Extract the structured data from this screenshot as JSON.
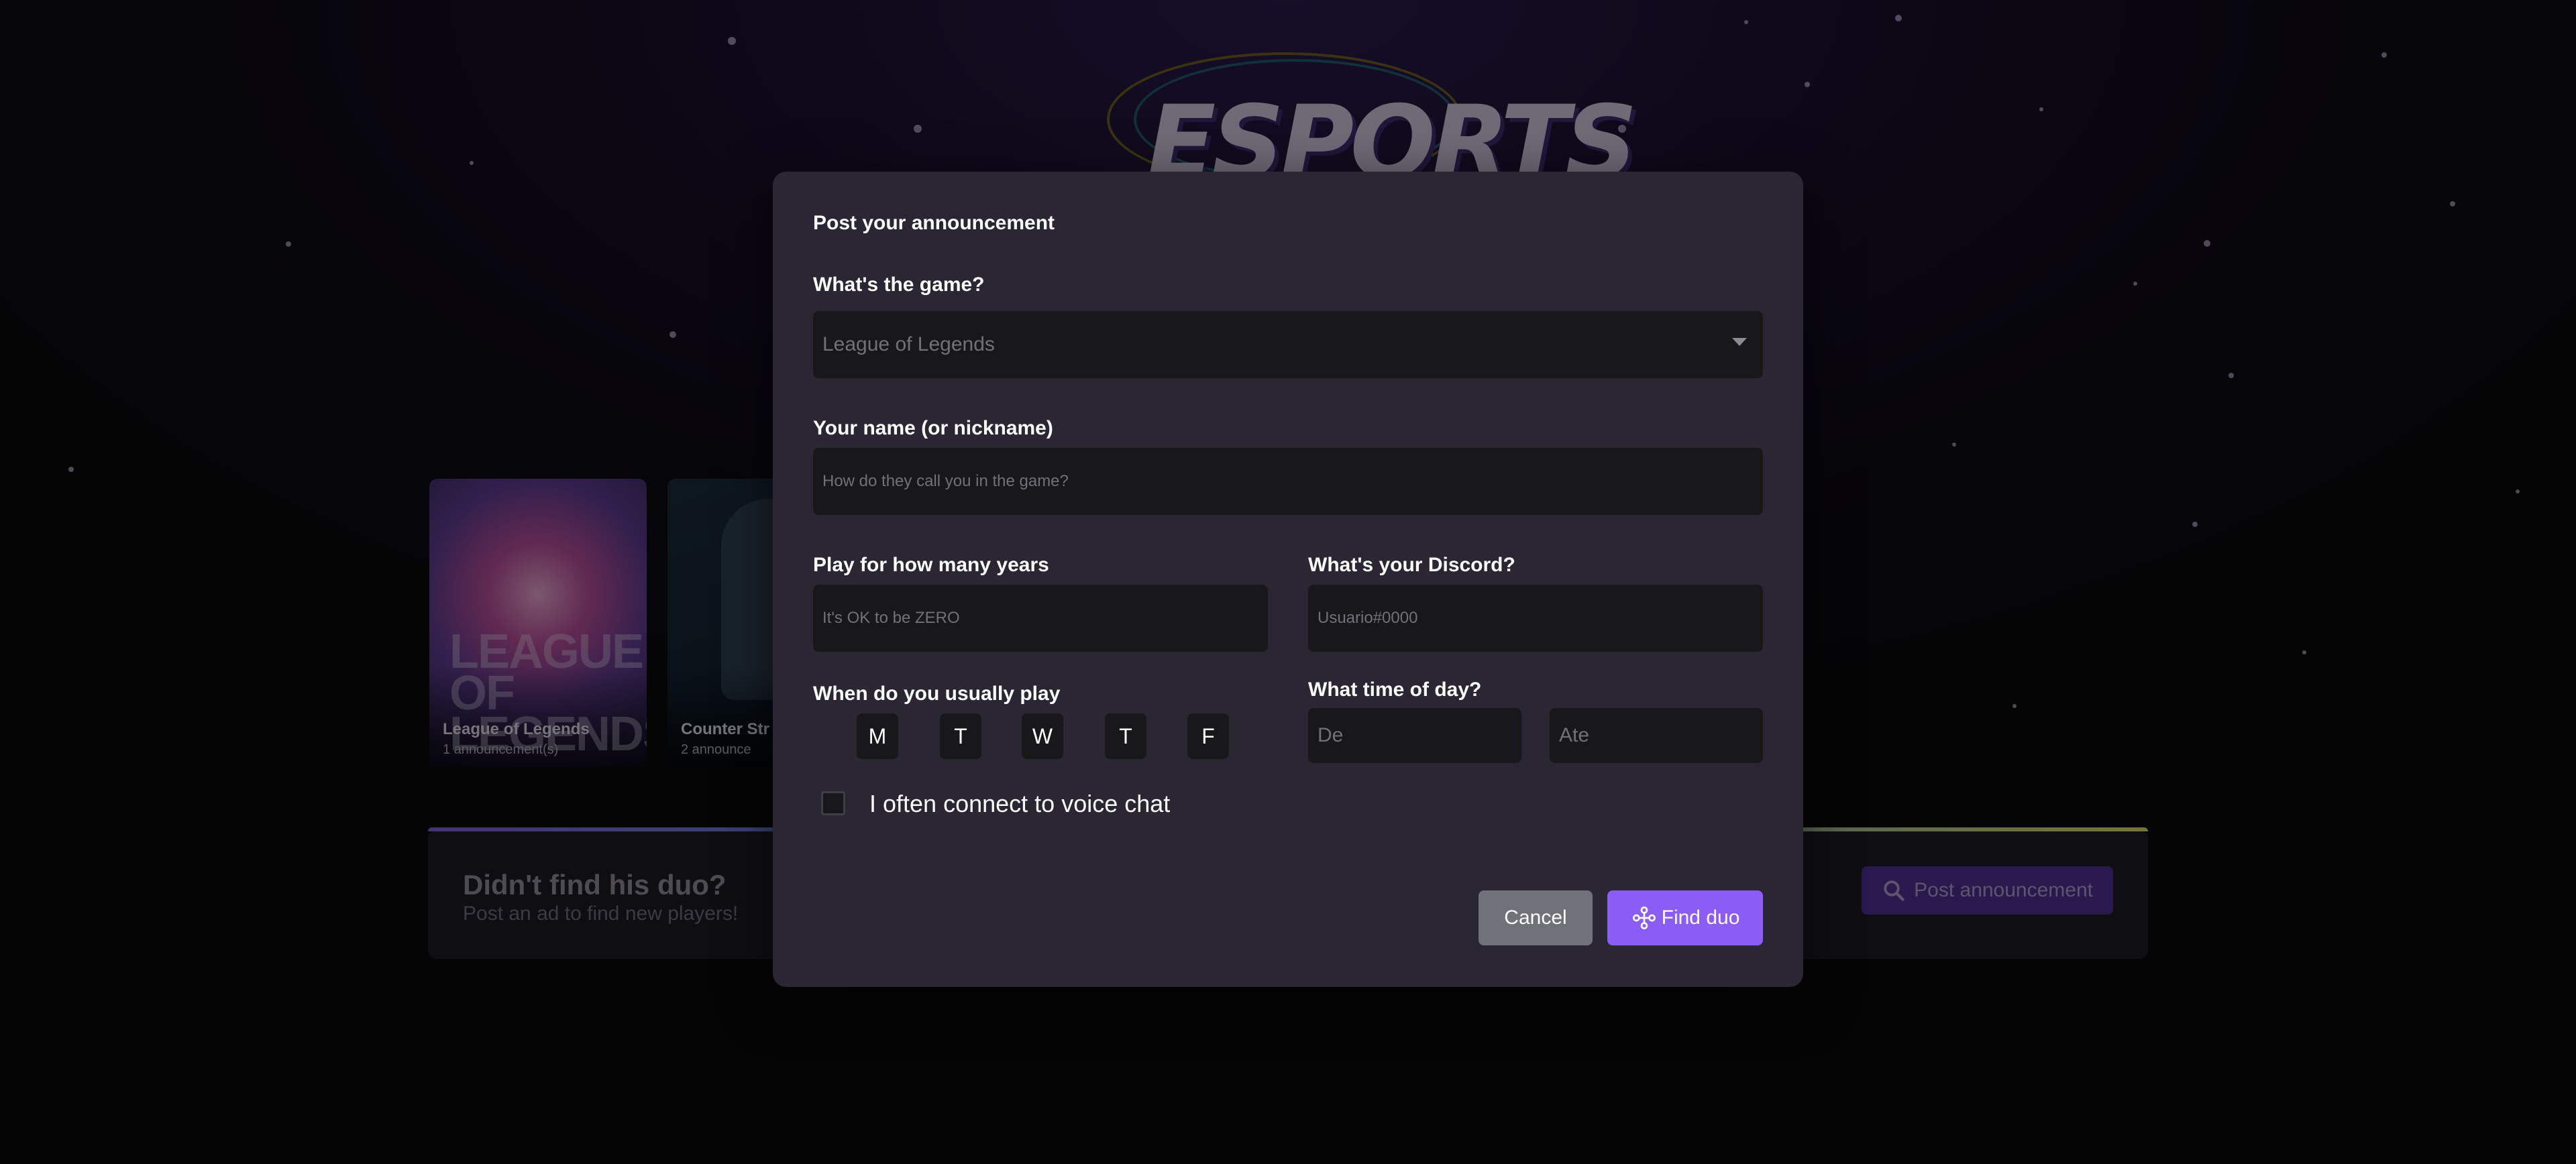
{
  "background": {
    "logo_text": "ESPORTS",
    "games": [
      {
        "name": "League of Legends",
        "count": "1 announcement(s)",
        "art_text": "LEAGUE OF LEGENDS"
      },
      {
        "name": "Counter Str",
        "count": "2 announce"
      }
    ],
    "banner": {
      "title": "Didn't find his duo?",
      "subtitle": "Post an ad to find new players!",
      "button_label": "Post announcement",
      "button_icon": "search-icon"
    }
  },
  "modal": {
    "title": "Post your announcement",
    "game": {
      "label": "What's the game?",
      "value": "League of Legends",
      "icon": "caret-down-icon"
    },
    "name": {
      "label": "Your name (or nickname)",
      "placeholder": "How do they call you in the game?"
    },
    "years": {
      "label": "Play for how many years",
      "placeholder": "It's OK to be ZERO"
    },
    "discord": {
      "label": "What's your Discord?",
      "placeholder": "Usuario#0000"
    },
    "days": {
      "label": "When do you usually play",
      "items": [
        "M",
        "T",
        "W",
        "T",
        "F"
      ]
    },
    "time": {
      "label": "What time of day?",
      "from_placeholder": "De",
      "to_placeholder": "Ate"
    },
    "voice_chat": {
      "label": "I often connect to voice chat",
      "checked": false
    },
    "cancel_label": "Cancel",
    "submit_label": "Find duo",
    "submit_icon": "gamepad-icon"
  },
  "colors": {
    "accent": "#8b5cf6",
    "modal_bg": "#2a2634",
    "input_bg": "#18181b",
    "cancel_bg": "#71717a"
  }
}
